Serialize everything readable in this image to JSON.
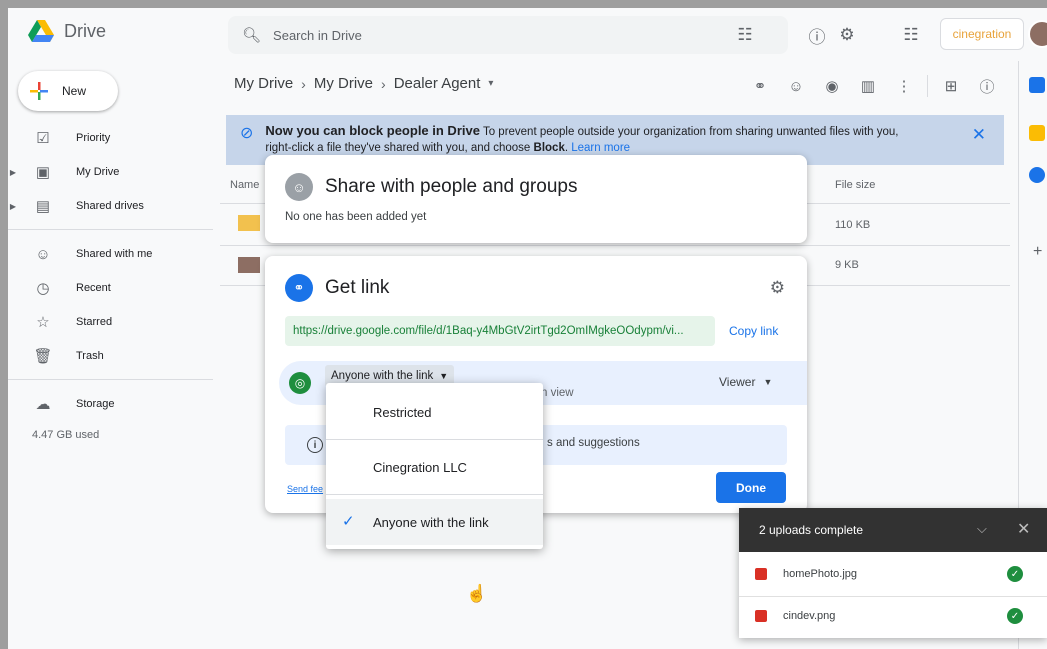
{
  "app": {
    "name": "Drive",
    "brand": "cinegration"
  },
  "search": {
    "placeholder": "Search in Drive"
  },
  "sidebar": {
    "new_label": "New",
    "items": [
      {
        "label": "Priority",
        "icon": "priority-icon"
      },
      {
        "label": "My Drive",
        "icon": "my-drive-icon"
      },
      {
        "label": "Shared drives",
        "icon": "shared-drives-icon"
      },
      {
        "label": "Shared with me",
        "icon": "shared-with-me-icon"
      },
      {
        "label": "Recent",
        "icon": "clock-icon"
      },
      {
        "label": "Starred",
        "icon": "star-icon"
      },
      {
        "label": "Trash",
        "icon": "trash-icon"
      },
      {
        "label": "Storage",
        "icon": "cloud-icon"
      }
    ],
    "storage_used": "4.47 GB used"
  },
  "breadcrumb": [
    "My Drive",
    "My Drive",
    "Dealer Agent"
  ],
  "banner": {
    "title": "Now you can block people in Drive",
    "body_1": "To prevent people outside your organization from sharing unwanted files with you,",
    "body_2_prefix": "right-click a file they've shared with you, and choose ",
    "body_2_bold": "Block",
    "learn_more": "Learn more"
  },
  "table": {
    "col_name": "Name",
    "col_size": "File size",
    "rows": [
      {
        "size": "110 KB"
      },
      {
        "size": "9 KB"
      }
    ]
  },
  "share_dialog": {
    "title": "Share with people and groups",
    "subtitle": "No one has been added yet"
  },
  "link_dialog": {
    "title": "Get link",
    "url": "https://drive.google.com/file/d/1Baq-y4MbGtV2irtTgd2OmIMgkeOOdypm/vi...",
    "copy_label": "Copy link",
    "access_value": "Anyone with the link",
    "access_desc_fragment": "n view",
    "role_value": "Viewer",
    "info_fragment": "s and suggestions",
    "send_feedback_fragment": "Send fee",
    "done_label": "Done"
  },
  "access_dropdown": {
    "options": [
      "Restricted",
      "Cinegration LLC",
      "Anyone with the link"
    ],
    "selected_index": 2
  },
  "uploads": {
    "header": "2 uploads complete",
    "files": [
      "homePhoto.jpg",
      "cindev.png"
    ]
  },
  "colors": {
    "accent": "#1a73e8",
    "success": "#1e8e3e",
    "link_bg": "#e6f4ea",
    "overlay": "#9e9e9e"
  }
}
